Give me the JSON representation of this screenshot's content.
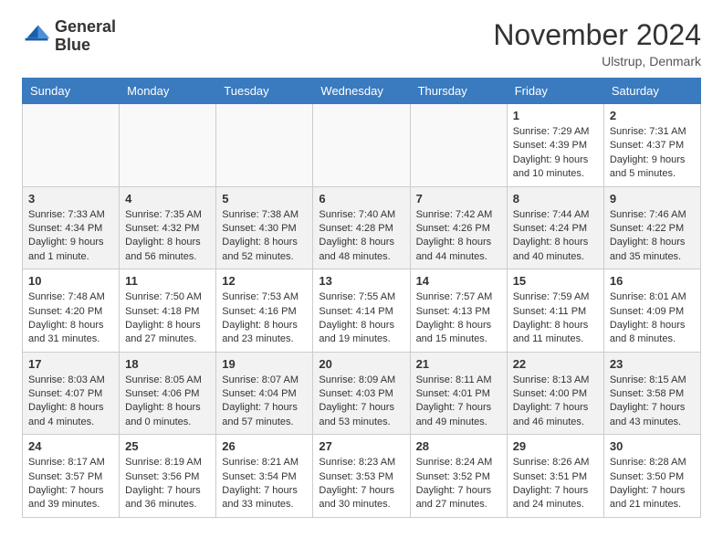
{
  "header": {
    "logo_line1": "General",
    "logo_line2": "Blue",
    "month": "November 2024",
    "location": "Ulstrup, Denmark"
  },
  "weekdays": [
    "Sunday",
    "Monday",
    "Tuesday",
    "Wednesday",
    "Thursday",
    "Friday",
    "Saturday"
  ],
  "weeks": [
    [
      {
        "day": "",
        "info": ""
      },
      {
        "day": "",
        "info": ""
      },
      {
        "day": "",
        "info": ""
      },
      {
        "day": "",
        "info": ""
      },
      {
        "day": "",
        "info": ""
      },
      {
        "day": "1",
        "info": "Sunrise: 7:29 AM\nSunset: 4:39 PM\nDaylight: 9 hours\nand 10 minutes."
      },
      {
        "day": "2",
        "info": "Sunrise: 7:31 AM\nSunset: 4:37 PM\nDaylight: 9 hours\nand 5 minutes."
      }
    ],
    [
      {
        "day": "3",
        "info": "Sunrise: 7:33 AM\nSunset: 4:34 PM\nDaylight: 9 hours\nand 1 minute."
      },
      {
        "day": "4",
        "info": "Sunrise: 7:35 AM\nSunset: 4:32 PM\nDaylight: 8 hours\nand 56 minutes."
      },
      {
        "day": "5",
        "info": "Sunrise: 7:38 AM\nSunset: 4:30 PM\nDaylight: 8 hours\nand 52 minutes."
      },
      {
        "day": "6",
        "info": "Sunrise: 7:40 AM\nSunset: 4:28 PM\nDaylight: 8 hours\nand 48 minutes."
      },
      {
        "day": "7",
        "info": "Sunrise: 7:42 AM\nSunset: 4:26 PM\nDaylight: 8 hours\nand 44 minutes."
      },
      {
        "day": "8",
        "info": "Sunrise: 7:44 AM\nSunset: 4:24 PM\nDaylight: 8 hours\nand 40 minutes."
      },
      {
        "day": "9",
        "info": "Sunrise: 7:46 AM\nSunset: 4:22 PM\nDaylight: 8 hours\nand 35 minutes."
      }
    ],
    [
      {
        "day": "10",
        "info": "Sunrise: 7:48 AM\nSunset: 4:20 PM\nDaylight: 8 hours\nand 31 minutes."
      },
      {
        "day": "11",
        "info": "Sunrise: 7:50 AM\nSunset: 4:18 PM\nDaylight: 8 hours\nand 27 minutes."
      },
      {
        "day": "12",
        "info": "Sunrise: 7:53 AM\nSunset: 4:16 PM\nDaylight: 8 hours\nand 23 minutes."
      },
      {
        "day": "13",
        "info": "Sunrise: 7:55 AM\nSunset: 4:14 PM\nDaylight: 8 hours\nand 19 minutes."
      },
      {
        "day": "14",
        "info": "Sunrise: 7:57 AM\nSunset: 4:13 PM\nDaylight: 8 hours\nand 15 minutes."
      },
      {
        "day": "15",
        "info": "Sunrise: 7:59 AM\nSunset: 4:11 PM\nDaylight: 8 hours\nand 11 minutes."
      },
      {
        "day": "16",
        "info": "Sunrise: 8:01 AM\nSunset: 4:09 PM\nDaylight: 8 hours\nand 8 minutes."
      }
    ],
    [
      {
        "day": "17",
        "info": "Sunrise: 8:03 AM\nSunset: 4:07 PM\nDaylight: 8 hours\nand 4 minutes."
      },
      {
        "day": "18",
        "info": "Sunrise: 8:05 AM\nSunset: 4:06 PM\nDaylight: 8 hours\nand 0 minutes."
      },
      {
        "day": "19",
        "info": "Sunrise: 8:07 AM\nSunset: 4:04 PM\nDaylight: 7 hours\nand 57 minutes."
      },
      {
        "day": "20",
        "info": "Sunrise: 8:09 AM\nSunset: 4:03 PM\nDaylight: 7 hours\nand 53 minutes."
      },
      {
        "day": "21",
        "info": "Sunrise: 8:11 AM\nSunset: 4:01 PM\nDaylight: 7 hours\nand 49 minutes."
      },
      {
        "day": "22",
        "info": "Sunrise: 8:13 AM\nSunset: 4:00 PM\nDaylight: 7 hours\nand 46 minutes."
      },
      {
        "day": "23",
        "info": "Sunrise: 8:15 AM\nSunset: 3:58 PM\nDaylight: 7 hours\nand 43 minutes."
      }
    ],
    [
      {
        "day": "24",
        "info": "Sunrise: 8:17 AM\nSunset: 3:57 PM\nDaylight: 7 hours\nand 39 minutes."
      },
      {
        "day": "25",
        "info": "Sunrise: 8:19 AM\nSunset: 3:56 PM\nDaylight: 7 hours\nand 36 minutes."
      },
      {
        "day": "26",
        "info": "Sunrise: 8:21 AM\nSunset: 3:54 PM\nDaylight: 7 hours\nand 33 minutes."
      },
      {
        "day": "27",
        "info": "Sunrise: 8:23 AM\nSunset: 3:53 PM\nDaylight: 7 hours\nand 30 minutes."
      },
      {
        "day": "28",
        "info": "Sunrise: 8:24 AM\nSunset: 3:52 PM\nDaylight: 7 hours\nand 27 minutes."
      },
      {
        "day": "29",
        "info": "Sunrise: 8:26 AM\nSunset: 3:51 PM\nDaylight: 7 hours\nand 24 minutes."
      },
      {
        "day": "30",
        "info": "Sunrise: 8:28 AM\nSunset: 3:50 PM\nDaylight: 7 hours\nand 21 minutes."
      }
    ]
  ]
}
